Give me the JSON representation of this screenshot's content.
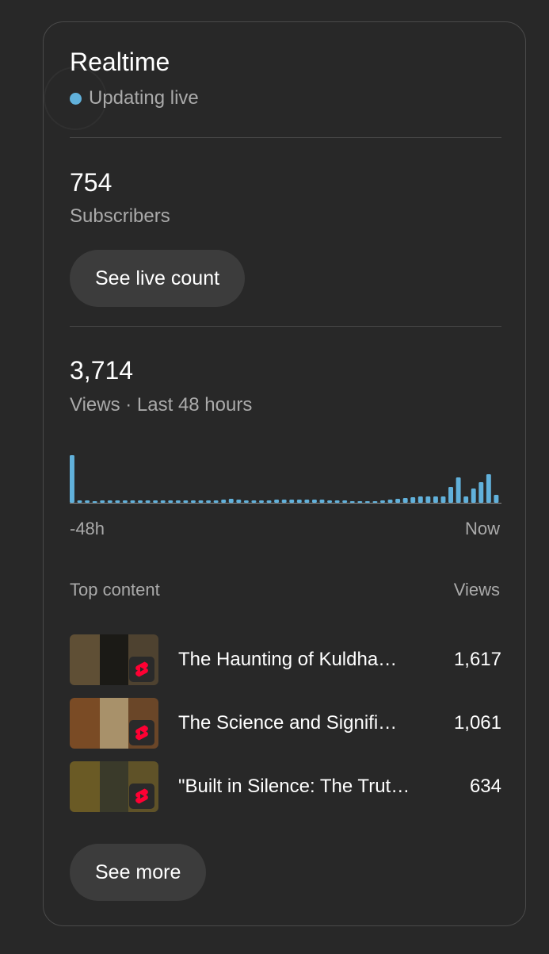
{
  "realtime": {
    "title": "Realtime",
    "status": "Updating live",
    "status_color": "#61b1db"
  },
  "subscribers": {
    "count": "754",
    "label": "Subscribers",
    "button_label": "See live count"
  },
  "views": {
    "count": "3,714",
    "label": "Views · Last 48 hours"
  },
  "chart_data": {
    "type": "bar",
    "bar_color": "#61b1db",
    "x_start_label": "-48h",
    "x_end_label": "Now",
    "values": [
      60,
      3,
      3,
      2,
      3,
      3,
      3,
      3,
      3,
      3,
      3,
      3,
      3,
      3,
      3,
      3,
      3,
      3,
      3,
      3,
      4,
      5,
      4,
      3,
      3,
      3,
      3,
      4,
      4,
      4,
      4,
      4,
      4,
      4,
      3,
      3,
      3,
      2,
      2,
      2,
      2,
      3,
      4,
      5,
      6,
      7,
      8,
      8,
      8,
      8,
      20,
      32,
      8,
      18,
      26,
      36,
      10
    ]
  },
  "top_content": {
    "heading": "Top content",
    "views_heading": "Views",
    "items": [
      {
        "title": "The Haunting of Kuldha…",
        "views": "1,617",
        "thumb_colors": [
          "#5f4f35",
          "#1b1a16",
          "#4e4230"
        ]
      },
      {
        "title": "The Science and Signifi…",
        "views": "1,061",
        "thumb_colors": [
          "#7a4b25",
          "#a8916a",
          "#6a4628"
        ]
      },
      {
        "title": "\"Built in Silence: The Trut…",
        "views": "634",
        "thumb_colors": [
          "#6a5a25",
          "#3a3a2a",
          "#5f5228"
        ]
      }
    ],
    "see_more_label": "See more"
  }
}
